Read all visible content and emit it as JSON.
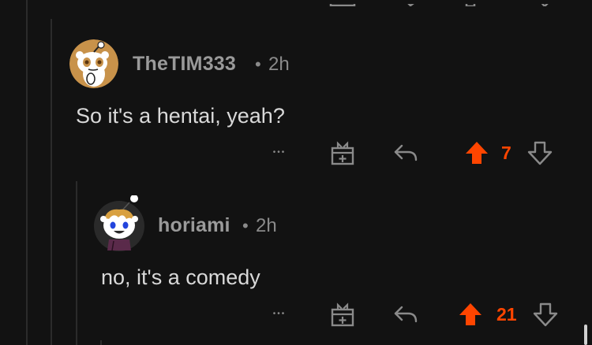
{
  "comments": [
    {
      "username": "TheTIM333",
      "separator": "•",
      "age": "2h",
      "text": "So it's a hentai, yeah?",
      "score": "7",
      "more_glyph": "•••"
    },
    {
      "username": "horiami",
      "separator": "•",
      "age": "2h",
      "text": "no, it's a comedy",
      "score": "21",
      "more_glyph": "•••"
    }
  ],
  "colors": {
    "background": "#121212",
    "upvote_active": "#ff4500",
    "icon_gray": "#8a8a8a",
    "text": "#d9d9d9",
    "username": "#9a9a9a"
  }
}
